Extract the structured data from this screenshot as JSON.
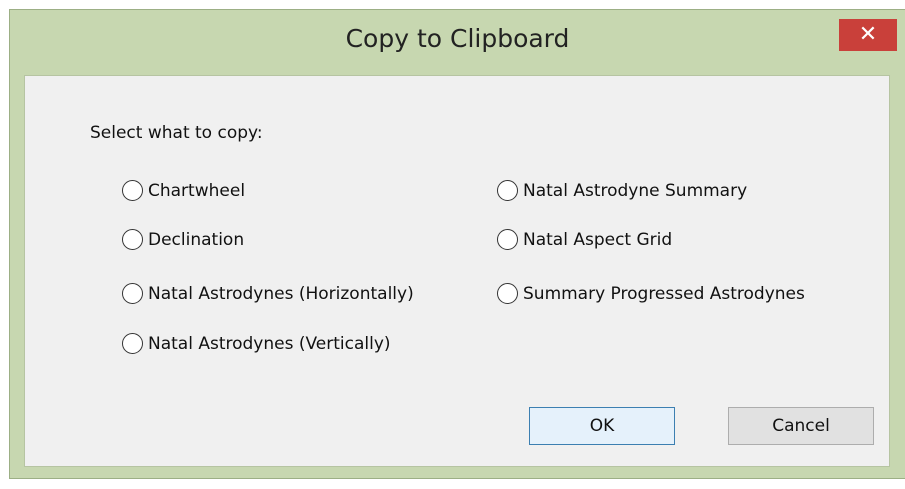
{
  "dialog": {
    "title": "Copy to Clipboard",
    "close_label": "✕"
  },
  "prompt": "Select what to copy:",
  "options": [
    {
      "label": "Chartwheel",
      "selected": false
    },
    {
      "label": "Declination",
      "selected": false
    },
    {
      "label": "Natal Astrodynes (Horizontally)",
      "selected": false
    },
    {
      "label": "Natal Astrodynes (Vertically)",
      "selected": false
    },
    {
      "label": "Natal Astrodyne Summary",
      "selected": false
    },
    {
      "label": "Natal Aspect Grid",
      "selected": false
    },
    {
      "label": "Summary Progressed Astrodynes",
      "selected": false
    }
  ],
  "buttons": {
    "ok_label": "OK",
    "cancel_label": "Cancel"
  },
  "colors": {
    "frame": "#c7d7b0",
    "close_button": "#c9403a",
    "client_background": "#f0f0f0",
    "default_button_border": "#3c7fb1"
  }
}
